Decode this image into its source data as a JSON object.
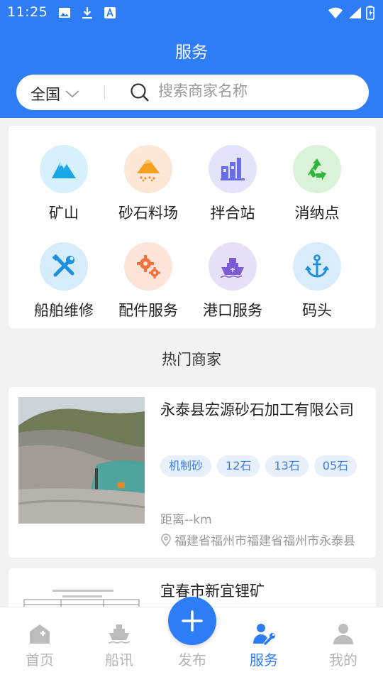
{
  "status_bar": {
    "time": "11:25",
    "icons": [
      "image-icon",
      "download-icon",
      "font-a-icon",
      "wifi-icon",
      "signal-icon",
      "battery-icon"
    ]
  },
  "header": {
    "title": "服务"
  },
  "search": {
    "region": "全国",
    "placeholder": "搜索商家名称"
  },
  "categories": [
    {
      "label": "矿山",
      "icon": "mountain-icon"
    },
    {
      "label": "砂石料场",
      "icon": "sand-pile-icon"
    },
    {
      "label": "拌合站",
      "icon": "factory-icon"
    },
    {
      "label": "消纳点",
      "icon": "recycle-icon"
    },
    {
      "label": "船舶维修",
      "icon": "tools-icon"
    },
    {
      "label": "配件服务",
      "icon": "gears-icon"
    },
    {
      "label": "港口服务",
      "icon": "ship-icon"
    },
    {
      "label": "码头",
      "icon": "anchor-icon"
    }
  ],
  "hot_section": {
    "title": "热门商家"
  },
  "merchants": [
    {
      "name": "永泰县宏源砂石加工有限公司",
      "tags": [
        "机制砂",
        "12石",
        "13石",
        "05石"
      ],
      "distance": "距离--km",
      "address": "福建省福州市福建省福州市永泰县"
    },
    {
      "name": "宜春市新宜锂矿",
      "tags": [],
      "distance": "",
      "address": ""
    }
  ],
  "tabbar": {
    "items": [
      {
        "label": "首页",
        "icon": "home-icon",
        "active": false
      },
      {
        "label": "船讯",
        "icon": "ship-news-icon",
        "active": false
      },
      {
        "label": "发布",
        "icon": "plus-icon",
        "active": false
      },
      {
        "label": "服务",
        "icon": "service-icon",
        "active": true
      },
      {
        "label": "我的",
        "icon": "user-icon",
        "active": false
      }
    ]
  },
  "colors": {
    "brand": "#2e7cf6",
    "tag_bg": "#e8f0fc",
    "tag_text": "#3d7be0",
    "inactive_tab": "#b5b5b5"
  }
}
